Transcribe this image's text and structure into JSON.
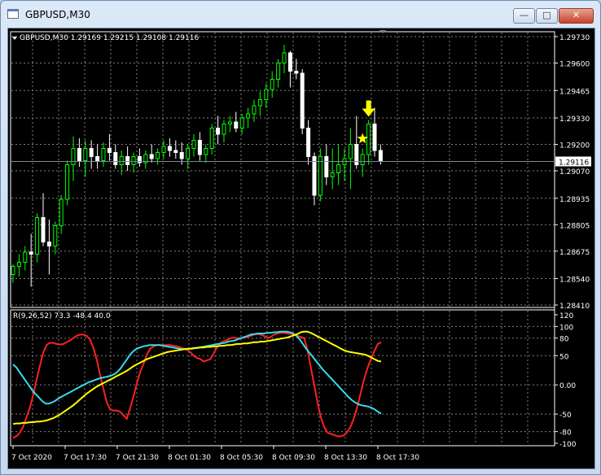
{
  "window": {
    "title": "GBPUSD,M30",
    "buttons": {
      "minimize": "—",
      "maximize": "□",
      "close": "✕"
    }
  },
  "chart_data": [
    {
      "type": "candlestick",
      "info_label": "GBPUSD,M30  1.29169 1.29215 1.29108 1.29116",
      "current_price": "1.29116",
      "ylim": [
        1.2841,
        1.2973
      ],
      "y_ticks": [
        "1.29730",
        "1.29600",
        "1.29465",
        "1.29330",
        "1.29200",
        "1.29070",
        "1.28935",
        "1.28805",
        "1.28675",
        "1.28540",
        "1.28410"
      ],
      "grid": true,
      "colors": {
        "background": "#000000",
        "bull": "#00ff00",
        "bear": "#ffffff",
        "grid": "#808080",
        "text": "#ffffff",
        "bid_line": "#7a8b9c"
      },
      "candles": [
        [
          1.2856,
          1.2861,
          1.2852,
          1.286
        ],
        [
          1.286,
          1.2866,
          1.2855,
          1.2862
        ],
        [
          1.2862,
          1.287,
          1.2858,
          1.2867
        ],
        [
          1.2867,
          1.2876,
          1.285,
          1.2866
        ],
        [
          1.2866,
          1.2886,
          1.2862,
          1.2884
        ],
        [
          1.2884,
          1.2896,
          1.287,
          1.2872
        ],
        [
          1.2872,
          1.2883,
          1.2856,
          1.287
        ],
        [
          1.287,
          1.2882,
          1.2866,
          1.288
        ],
        [
          1.288,
          1.2895,
          1.2876,
          1.2893
        ],
        [
          1.2893,
          1.2912,
          1.289,
          1.291
        ],
        [
          1.291,
          1.2924,
          1.2902,
          1.2918
        ],
        [
          1.2918,
          1.2923,
          1.2909,
          1.2912
        ],
        [
          1.2912,
          1.2922,
          1.2904,
          1.2918
        ],
        [
          1.2918,
          1.2922,
          1.2908,
          1.2914
        ],
        [
          1.2914,
          1.292,
          1.2908,
          1.2912
        ],
        [
          1.2912,
          1.2921,
          1.2909,
          1.2918
        ],
        [
          1.2918,
          1.2925,
          1.2912,
          1.2916
        ],
        [
          1.2916,
          1.292,
          1.2908,
          1.291
        ],
        [
          1.291,
          1.2917,
          1.2905,
          1.2914
        ],
        [
          1.2914,
          1.2919,
          1.2907,
          1.291
        ],
        [
          1.291,
          1.2916,
          1.2906,
          1.2914
        ],
        [
          1.2914,
          1.2918,
          1.2909,
          1.2911
        ],
        [
          1.2911,
          1.2917,
          1.2908,
          1.2915
        ],
        [
          1.2915,
          1.292,
          1.2911,
          1.2913
        ],
        [
          1.2913,
          1.2918,
          1.291,
          1.2916
        ],
        [
          1.2916,
          1.2922,
          1.2913,
          1.2919
        ],
        [
          1.2919,
          1.2923,
          1.2914,
          1.2917
        ],
        [
          1.2917,
          1.2922,
          1.2913,
          1.2916
        ],
        [
          1.2916,
          1.2921,
          1.291,
          1.2913
        ],
        [
          1.2913,
          1.292,
          1.2908,
          1.2918
        ],
        [
          1.2918,
          1.2925,
          1.2914,
          1.2922
        ],
        [
          1.2922,
          1.2926,
          1.2912,
          1.2915
        ],
        [
          1.2915,
          1.292,
          1.2911,
          1.2918
        ],
        [
          1.2918,
          1.293,
          1.2915,
          1.2928
        ],
        [
          1.2928,
          1.2934,
          1.292,
          1.2925
        ],
        [
          1.2925,
          1.2932,
          1.2921,
          1.293
        ],
        [
          1.293,
          1.2934,
          1.2926,
          1.2931
        ],
        [
          1.2931,
          1.2936,
          1.2926,
          1.2928
        ],
        [
          1.2928,
          1.2935,
          1.2925,
          1.2933
        ],
        [
          1.2933,
          1.2938,
          1.2928,
          1.2935
        ],
        [
          1.2935,
          1.2942,
          1.2931,
          1.2939
        ],
        [
          1.2939,
          1.2946,
          1.2934,
          1.2942
        ],
        [
          1.2942,
          1.295,
          1.2938,
          1.2947
        ],
        [
          1.2947,
          1.2956,
          1.2943,
          1.2952
        ],
        [
          1.2952,
          1.2962,
          1.2948,
          1.296
        ],
        [
          1.296,
          1.2969,
          1.2955,
          1.2965
        ],
        [
          1.2965,
          1.2966,
          1.2948,
          1.2956
        ],
        [
          1.2956,
          1.2962,
          1.2952,
          1.2955
        ],
        [
          1.2955,
          1.2957,
          1.2925,
          1.2928
        ],
        [
          1.2928,
          1.2932,
          1.291,
          1.2914
        ],
        [
          1.2914,
          1.2916,
          1.289,
          1.2895
        ],
        [
          1.2895,
          1.2918,
          1.2892,
          1.2914
        ],
        [
          1.2914,
          1.292,
          1.29,
          1.2904
        ],
        [
          1.2904,
          1.2918,
          1.2898,
          1.2906
        ],
        [
          1.2906,
          1.292,
          1.29,
          1.291
        ],
        [
          1.291,
          1.2918,
          1.2902,
          1.2913
        ],
        [
          1.2913,
          1.2928,
          1.2898,
          1.292
        ],
        [
          1.292,
          1.2934,
          1.2908,
          1.291
        ],
        [
          1.291,
          1.2918,
          1.2904,
          1.2915
        ],
        [
          1.2915,
          1.2932,
          1.291,
          1.293
        ],
        [
          1.293,
          1.2938,
          1.2914,
          1.2917
        ],
        [
          1.2917,
          1.292,
          1.291,
          1.2912
        ]
      ],
      "markers": {
        "star_index": 58,
        "arrow_index": 59,
        "color": "#ffff00"
      }
    },
    {
      "type": "line",
      "info_label": "R(9,26,52) 73.3 -48.4 40.0",
      "ylim": [
        -100,
        120
      ],
      "y_ticks": [
        "120",
        "100",
        "80",
        "50",
        "0.00",
        "-50",
        "-80",
        "-100"
      ],
      "x_tick_labels": [
        "7 Oct 2020",
        "7 Oct 17:30",
        "7 Oct 21:30",
        "8 Oct 01:30",
        "8 Oct 05:30",
        "8 Oct 09:30",
        "8 Oct 13:30",
        "8 Oct 17:30"
      ],
      "series": [
        {
          "color": "#ff2020",
          "values": [
            -91,
            -88,
            -82,
            -72,
            -56,
            -40,
            -18,
            8,
            32,
            55,
            68,
            72,
            72,
            70,
            69,
            70,
            73,
            76,
            80,
            84,
            86,
            86,
            84,
            78,
            64,
            44,
            18,
            -6,
            -30,
            -42,
            -44,
            -44,
            -46,
            -52,
            -58,
            -40,
            -20,
            2,
            22,
            36,
            52,
            62,
            66,
            68,
            68,
            68,
            68,
            68,
            67,
            66,
            64,
            62,
            60,
            56,
            50,
            46,
            44,
            40,
            42,
            44,
            54,
            65,
            72,
            75,
            77,
            80,
            81,
            80,
            80,
            81,
            82,
            84,
            86,
            87,
            86,
            84,
            80,
            82,
            86,
            88,
            89,
            89,
            88,
            87,
            86,
            84,
            82,
            80,
            60,
            30,
            0,
            -30,
            -56,
            -72,
            -82,
            -84,
            -86,
            -88,
            -88,
            -86,
            -80,
            -70,
            -55,
            -35,
            -12,
            12,
            30,
            45,
            58,
            70,
            73
          ]
        },
        {
          "color": "#33ddee",
          "values": [
            35,
            30,
            22,
            14,
            6,
            -2,
            -10,
            -16,
            -22,
            -28,
            -32,
            -32,
            -30,
            -27,
            -23,
            -20,
            -17,
            -14,
            -11,
            -8,
            -5,
            -2,
            1,
            4,
            6,
            8,
            10,
            12,
            13,
            14,
            16,
            18,
            22,
            28,
            36,
            44,
            52,
            58,
            62,
            64,
            66,
            67,
            68,
            68,
            68,
            68,
            67,
            66,
            65,
            64,
            63,
            62,
            61,
            61,
            62,
            62,
            63,
            64,
            65,
            66,
            67,
            68,
            69,
            70,
            71,
            72,
            74,
            75,
            76,
            78,
            80,
            82,
            84,
            86,
            87,
            88,
            88,
            88,
            89,
            89,
            90,
            90,
            91,
            91,
            91,
            90,
            88,
            84,
            78,
            70,
            62,
            55,
            48,
            41,
            34,
            27,
            21,
            15,
            9,
            3,
            -3,
            -9,
            -15,
            -21,
            -26,
            -30,
            -33,
            -35,
            -36,
            -37,
            -39,
            -42,
            -46,
            -49
          ]
        },
        {
          "color": "#ffff00",
          "values": [
            -67,
            -66,
            -66,
            -65,
            -65,
            -64,
            -64,
            -63,
            -63,
            -62,
            -61,
            -59,
            -57,
            -54,
            -51,
            -47,
            -43,
            -39,
            -35,
            -30,
            -25,
            -20,
            -15,
            -11,
            -7,
            -3,
            0,
            3,
            6,
            9,
            12,
            15,
            18,
            21,
            24,
            28,
            32,
            35,
            38,
            41,
            44,
            46,
            48,
            50,
            52,
            54,
            56,
            57,
            58,
            59,
            60,
            61,
            62,
            62,
            63,
            63,
            64,
            64,
            65,
            65,
            66,
            66,
            67,
            67,
            68,
            68,
            69,
            70,
            70,
            71,
            71,
            72,
            73,
            73,
            74,
            74,
            75,
            76,
            77,
            78,
            79,
            80,
            81,
            83,
            85,
            87,
            90,
            91,
            91,
            89,
            86,
            83,
            80,
            77,
            74,
            71,
            68,
            65,
            62,
            59,
            57,
            56,
            55,
            54,
            53,
            52,
            50,
            47,
            44,
            41,
            40
          ]
        }
      ]
    }
  ]
}
